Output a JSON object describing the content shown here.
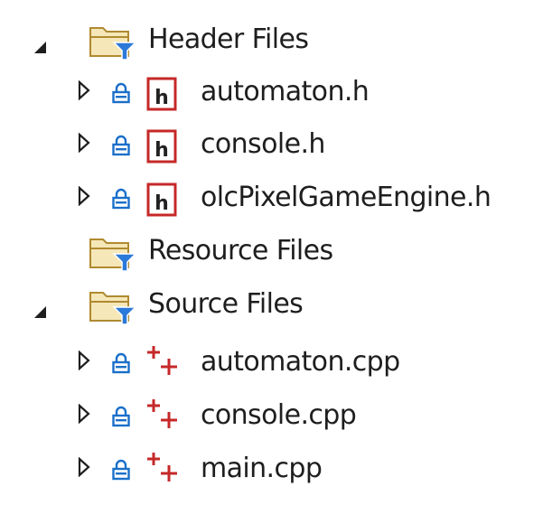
{
  "solution_explorer": {
    "colors": {
      "folder": "#c9a24a",
      "filter": "#2b79d8",
      "lock": "#1a6fc9",
      "header_icon": "#c62828",
      "cpp_icon": "#c62828",
      "arrow": "#1e1e1e"
    },
    "nodes": [
      {
        "kind": "folder",
        "label": "Header Files",
        "expanded": true,
        "icon": "filter-folder-icon"
      },
      {
        "kind": "file",
        "label": "automaton.h",
        "icon": "header-file-icon"
      },
      {
        "kind": "file",
        "label": "console.h",
        "icon": "header-file-icon"
      },
      {
        "kind": "file",
        "label": "olcPixelGameEngine.h",
        "icon": "header-file-icon"
      },
      {
        "kind": "folder",
        "label": "Resource Files",
        "expanded": null,
        "icon": "filter-folder-icon"
      },
      {
        "kind": "folder",
        "label": "Source Files",
        "expanded": true,
        "icon": "filter-folder-icon"
      },
      {
        "kind": "file",
        "label": "automaton.cpp",
        "icon": "cpp-file-icon"
      },
      {
        "kind": "file",
        "label": "console.cpp",
        "icon": "cpp-file-icon"
      },
      {
        "kind": "file",
        "label": "main.cpp",
        "icon": "cpp-file-icon"
      }
    ]
  }
}
